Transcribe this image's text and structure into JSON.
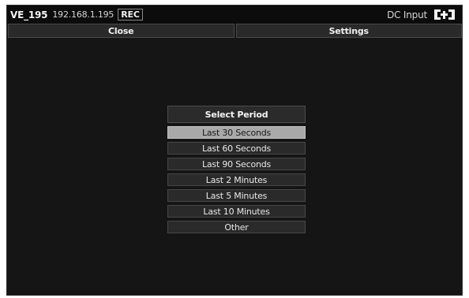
{
  "titlebar": {
    "device_name": "VE_195",
    "ip_address": "192.168.1.195",
    "rec_badge": "REC",
    "power_label": "DC Input",
    "power_icon": "dc-plug-icon"
  },
  "toolbar": {
    "close_label": "Close",
    "settings_label": "Settings"
  },
  "period_menu": {
    "header": "Select Period",
    "selected_index": 0,
    "items": [
      {
        "label": "Last 30 Seconds"
      },
      {
        "label": "Last 60 Seconds"
      },
      {
        "label": "Last 90 Seconds"
      },
      {
        "label": "Last 2 Minutes"
      },
      {
        "label": "Last 5 Minutes"
      },
      {
        "label": "Last 10 Minutes"
      },
      {
        "label": "Other"
      }
    ]
  },
  "colors": {
    "background": "#151515",
    "titlebar": "#0c0c0c",
    "button": "#2a2a2a",
    "selected_item": "#a9a9a9"
  }
}
